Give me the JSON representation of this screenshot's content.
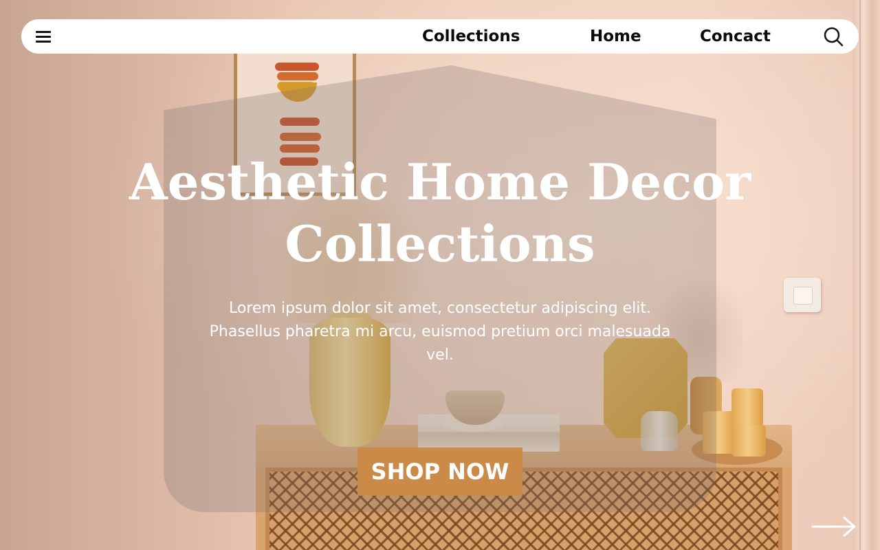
{
  "nav": {
    "menu_icon": "hamburger-menu-icon",
    "links": [
      "Collections",
      "Home",
      "Concact"
    ],
    "search_icon": "search-icon"
  },
  "hero": {
    "title_line1": "Aesthetic  Home  Decor",
    "title_line2": "Collections",
    "body": "Lorem ipsum dolor sit amet, consectetur adipiscing elit. Phasellus pharetra mi arcu, euismod pretium orci malesuada vel.",
    "cta_label": "SHOP NOW",
    "next_icon": "arrow-right-icon"
  },
  "colors": {
    "cta_background": "#cc8a48",
    "text": "#ffffff",
    "nav_background": "#ffffff"
  }
}
